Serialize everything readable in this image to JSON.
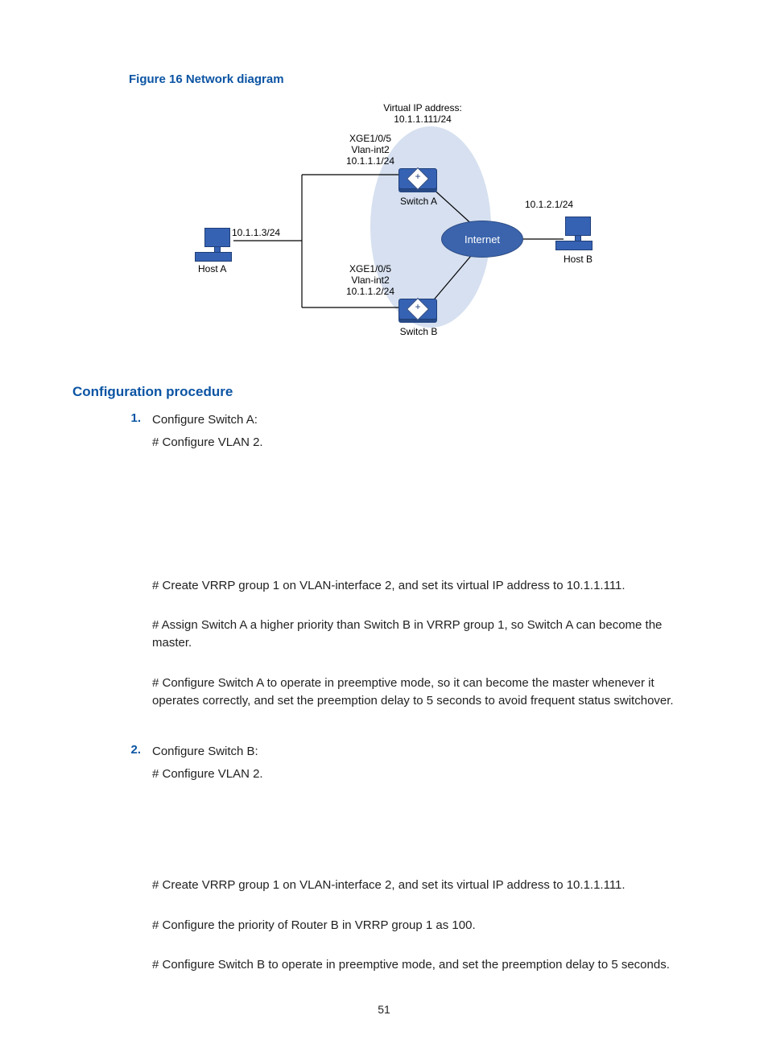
{
  "figure": {
    "caption": "Figure 16 Network diagram",
    "virtual_ip_l1": "Virtual IP address:",
    "virtual_ip_l2": "10.1.1.111/24",
    "switch_a_if_l1": "XGE1/0/5",
    "switch_a_if_l2": "Vlan-int2",
    "switch_a_if_l3": "10.1.1.1/24",
    "switch_a": "Switch A",
    "switch_b_if_l1": "XGE1/0/5",
    "switch_b_if_l2": "Vlan-int2",
    "switch_b_if_l3": "10.1.1.2/24",
    "switch_b": "Switch B",
    "host_a_ip": "10.1.1.3/24",
    "host_a": "Host A",
    "host_b_ip": "10.1.2.1/24",
    "host_b": "Host B",
    "internet": "Internet"
  },
  "heading": "Configuration procedure",
  "step1": {
    "num": "1.",
    "l1": "Configure Switch A:",
    "l2": "# Configure VLAN 2.",
    "l3": "# Create VRRP group 1 on VLAN-interface 2, and set its virtual IP address to 10.1.1.111.",
    "l4": "# Assign Switch A a higher priority than Switch B in VRRP group 1, so Switch A can become the master.",
    "l5": "# Configure Switch A to operate in preemptive mode, so it can become the master whenever it operates correctly, and set the preemption delay to 5 seconds to avoid frequent status switchover."
  },
  "step2": {
    "num": "2.",
    "l1": "Configure Switch B:",
    "l2": "# Configure VLAN 2.",
    "l3": "# Create VRRP group 1 on VLAN-interface 2, and set its virtual IP address to 10.1.1.111.",
    "l4": "# Configure the priority of Router B in VRRP group 1 as 100.",
    "l5": "# Configure Switch B to operate in preemptive mode, and set the preemption delay to 5 seconds."
  },
  "page_number": "51"
}
